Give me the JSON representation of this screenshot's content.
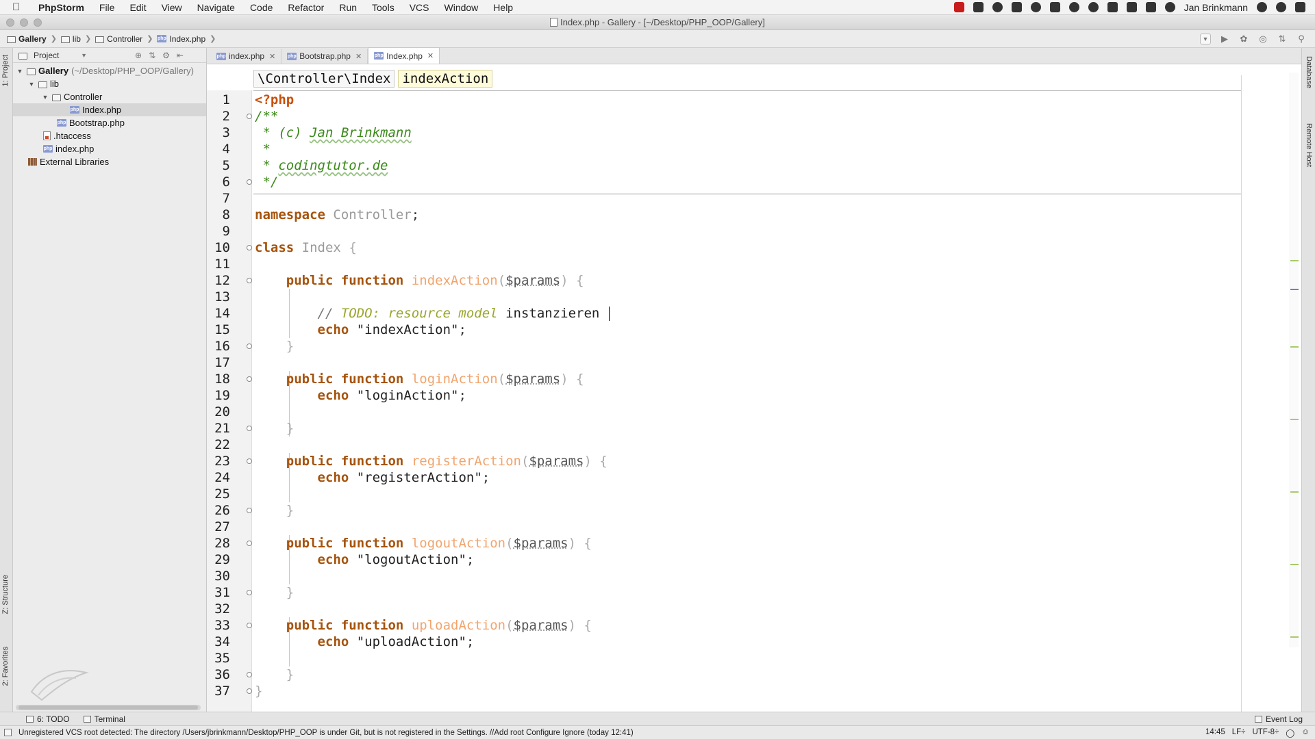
{
  "menubar": {
    "app_name": "PhpStorm",
    "items": [
      "File",
      "Edit",
      "View",
      "Navigate",
      "Code",
      "Refactor",
      "Run",
      "Tools",
      "VCS",
      "Window",
      "Help"
    ],
    "user": "Jan Brinkmann"
  },
  "window": {
    "title": "Index.php - Gallery - [~/Desktop/PHP_OOP/Gallery]"
  },
  "breadcrumbs": [
    "Gallery",
    "lib",
    "Controller",
    "Index.php"
  ],
  "left_stripe": {
    "project_tab": "1: Project",
    "structure_tab": "Z: Structure",
    "favorites_tab": "2: Favorites"
  },
  "right_stripe": {
    "database_tab": "Database",
    "remote_host_tab": "Remote Host"
  },
  "project_panel": {
    "dropdown_label": "Project",
    "tree": [
      {
        "label": "Gallery",
        "hint": "(~/Desktop/PHP_OOP/Gallery)"
      },
      {
        "label": "lib"
      },
      {
        "label": "Controller"
      },
      {
        "label": "Index.php"
      },
      {
        "label": "Bootstrap.php"
      },
      {
        "label": ".htaccess"
      },
      {
        "label": "index.php"
      },
      {
        "label": "External Libraries"
      }
    ]
  },
  "editor_tabs": [
    {
      "label": "index.php"
    },
    {
      "label": "Bootstrap.php"
    },
    {
      "label": "Index.php"
    }
  ],
  "editor_breadcrumbs": [
    "\\Controller\\Index",
    "indexAction"
  ],
  "code": {
    "line_numbers": [
      "1",
      "2",
      "3",
      "4",
      "5",
      "6",
      "7",
      "8",
      "9",
      "10",
      "11",
      "12",
      "13",
      "14",
      "15",
      "16",
      "17",
      "18",
      "19",
      "20",
      "21",
      "22",
      "23",
      "24",
      "25",
      "26",
      "27",
      "28",
      "29",
      "30",
      "31",
      "32",
      "33",
      "34",
      "35",
      "36",
      "37"
    ],
    "php_open": "<?php",
    "doc_open": "/**",
    "doc_author_prefix": " * (c) ",
    "doc_author": "Jan Brinkmann",
    "doc_star": " *",
    "doc_site_prefix": " * ",
    "doc_site": "codingtutor.de",
    "doc_close": " */",
    "namespace_kw": "namespace",
    "namespace_name": "Controller",
    "semicolon": ";",
    "class_kw": "class",
    "class_name": "Index",
    "open_brace": "{",
    "close_brace": "}",
    "public_function": "public function",
    "open_paren": "(",
    "param": "$params",
    "paren_brace": ") {",
    "comment_slashes": "// ",
    "comment_todo": "TODO: resource model",
    "comment_rest": " instanzieren",
    "echo_kw": "echo",
    "methods": [
      {
        "name": "indexAction",
        "echo": "\"indexAction\""
      },
      {
        "name": "loginAction",
        "echo": "\"loginAction\""
      },
      {
        "name": "registerAction",
        "echo": "\"registerAction\""
      },
      {
        "name": "logoutAction",
        "echo": "\"logoutAction\""
      },
      {
        "name": "uploadAction",
        "echo": "\"uploadAction\""
      }
    ]
  },
  "bottom_tools": {
    "todo": "6: TODO",
    "terminal": "Terminal",
    "event_log": "Event Log"
  },
  "statusbar": {
    "message_start": "Unregistered VCS root detected: The directory /Users/jbrinkmann/Desktop/PHP_OOP is under Git, but is not registered in the Settings. // ",
    "add_root": "Add root",
    "configure": "Configure",
    "ignore": "Ignore",
    "message_end": "(today 12:41)",
    "position": "14:45",
    "line_sep": "LF÷",
    "encoding": "UTF-8÷"
  }
}
